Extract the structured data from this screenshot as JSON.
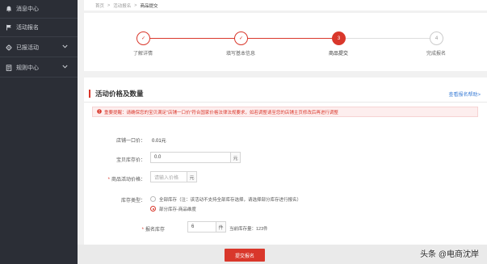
{
  "sidebar": {
    "items": [
      {
        "label": "消息中心",
        "icon": "bell-icon"
      },
      {
        "label": "活动报名",
        "icon": "flag-icon"
      },
      {
        "label": "已报活动",
        "icon": "gear-icon"
      },
      {
        "label": "规则中心",
        "icon": "document-icon"
      }
    ]
  },
  "breadcrumb": {
    "home": "首页",
    "sep1": ">",
    "parent": "活动报名",
    "sep2": ">",
    "current": "商品提交"
  },
  "steps": [
    {
      "label": "了解详情",
      "mark": "✓",
      "state": "done"
    },
    {
      "label": "填写基本信息",
      "mark": "✓",
      "state": "done"
    },
    {
      "label": "商品提交",
      "mark": "3",
      "state": "active"
    },
    {
      "label": "完成报名",
      "mark": "4",
      "state": "todo"
    }
  ],
  "section": {
    "title": "活动价格及数量",
    "help": "查看报名帮助>",
    "notice": "重要提醒：请确保您的宝贝满足\"店铺一口价\"符合国家价格法律法规要求，如若调整请至您的店铺主页修改后再进行调整"
  },
  "fields": {
    "shop_price_label": "店铺一口价：",
    "shop_price_value": "0.01元",
    "stock_label": "宝贝库存价：",
    "stock_value": "0.0",
    "stock_unit": "元",
    "activity_price_required": "*",
    "activity_price_label": "商品活动价格：",
    "activity_price_placeholder": "请输入价格",
    "activity_price_unit": "元",
    "inventory_type_label": "库存类型：",
    "inventory_all": "全部库存（注：该活动不支持全部库存选择，请选择部分库存进行报名）",
    "inventory_partial": "部分库存-商品维度",
    "signup_stock_required": "*",
    "signup_stock_label": "报名库存",
    "signup_stock_value": "6",
    "signup_stock_unit": "件",
    "current_stock_text": "当前库存量：123件"
  },
  "footer": {
    "submit": "提交报名",
    "watermark": "头条 @电商沈岸"
  },
  "colors": {
    "accent": "#d9372b",
    "sidebar": "#2b2e36",
    "link": "#3a7dd6"
  }
}
